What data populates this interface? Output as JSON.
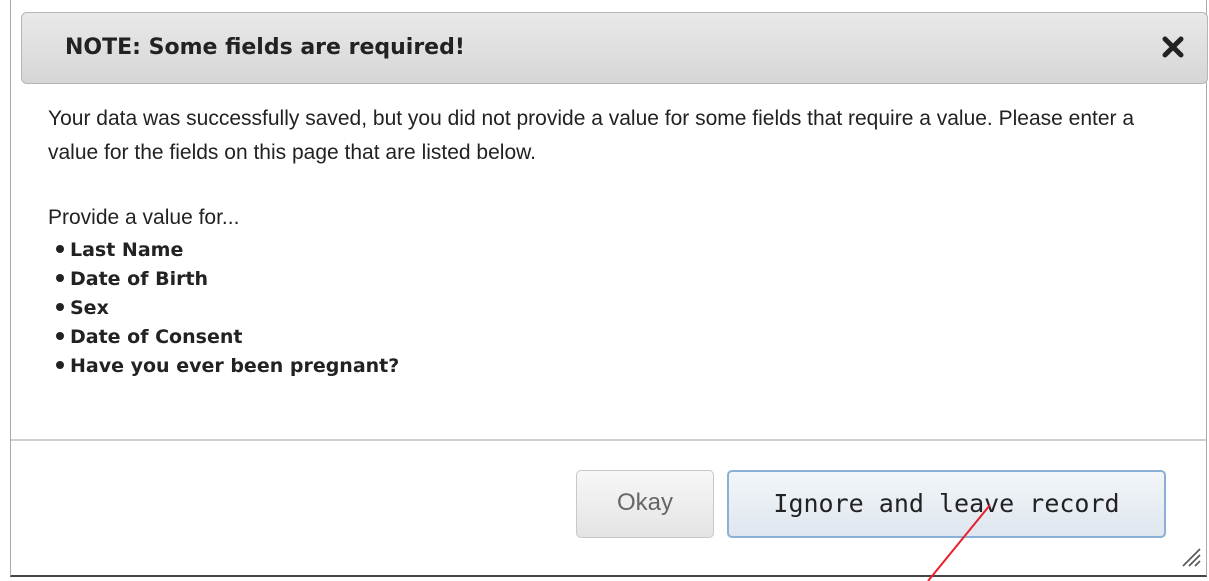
{
  "dialog": {
    "title": "NOTE: Some fields are required!",
    "close_icon": "close-icon",
    "message": "Your data was successfully saved, but you did not provide a value for some fields that require a value. Please enter a value for the fields on this page that are listed below.",
    "provide_label": "Provide a value for...",
    "required_fields": [
      "Last Name",
      "Date of Birth",
      "Sex",
      "Date of Consent",
      "Have you ever been pregnant?"
    ],
    "buttons": {
      "okay_label": "Okay",
      "ignore_label": "Ignore and leave record"
    },
    "resize_icon": "resize-grip-icon"
  },
  "colors": {
    "annotation_line": "#e8202a",
    "ignore_button_border": "#8ab0d8",
    "title_background": "#dcdcdc"
  }
}
